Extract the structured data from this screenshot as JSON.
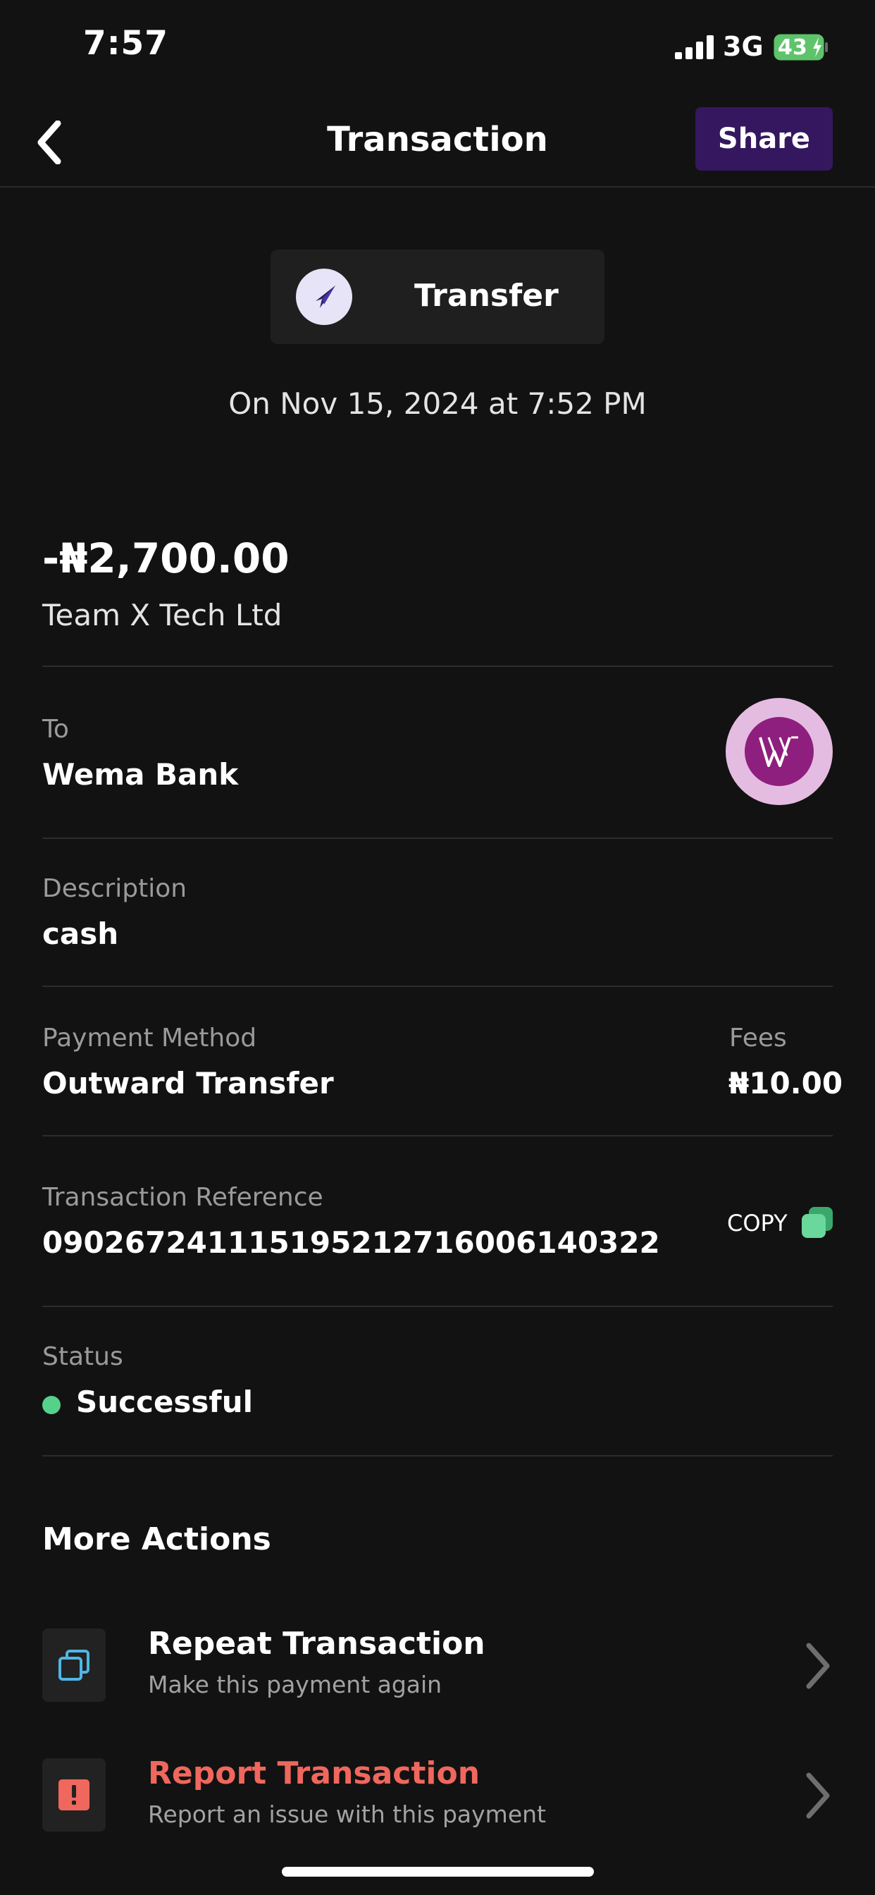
{
  "status_bar": {
    "time": "7:57",
    "network": "3G",
    "battery": "43"
  },
  "header": {
    "title": "Transaction",
    "share_label": "Share"
  },
  "transaction": {
    "type": "Transfer",
    "date": "On Nov 15, 2024 at 7:52 PM",
    "amount": "-₦2,700.00",
    "recipient": "Team X Tech Ltd",
    "to_label": "To",
    "to_value": "Wema Bank",
    "description_label": "Description",
    "description_value": "cash",
    "payment_method_label": "Payment Method",
    "payment_method_value": "Outward Transfer",
    "fees_label": "Fees",
    "fees_value": "₦10.00",
    "reference_label": "Transaction Reference",
    "reference_value": "090267241115195212716006140322",
    "copy_label": "COPY",
    "status_label": "Status",
    "status_value": "Successful"
  },
  "more_actions": {
    "title": "More Actions",
    "items": [
      {
        "title": "Repeat Transaction",
        "subtitle": "Make this payment again"
      },
      {
        "title": "Report Transaction",
        "subtitle": "Report an issue with this payment"
      }
    ]
  },
  "colors": {
    "background": "#121212",
    "share_button": "#35175f",
    "status_success": "#56d18a",
    "report_accent": "#f0675d",
    "repeat_icon": "#4fb6e6",
    "battery_fill": "#5fc36b"
  },
  "icons": {
    "back": "chevron-left-icon",
    "transfer": "send-arrow-icon",
    "bank": "wema-bank-logo",
    "copy": "copy-icon",
    "repeat": "repeat-icon",
    "report": "alert-icon",
    "chevron": "chevron-right-icon"
  }
}
